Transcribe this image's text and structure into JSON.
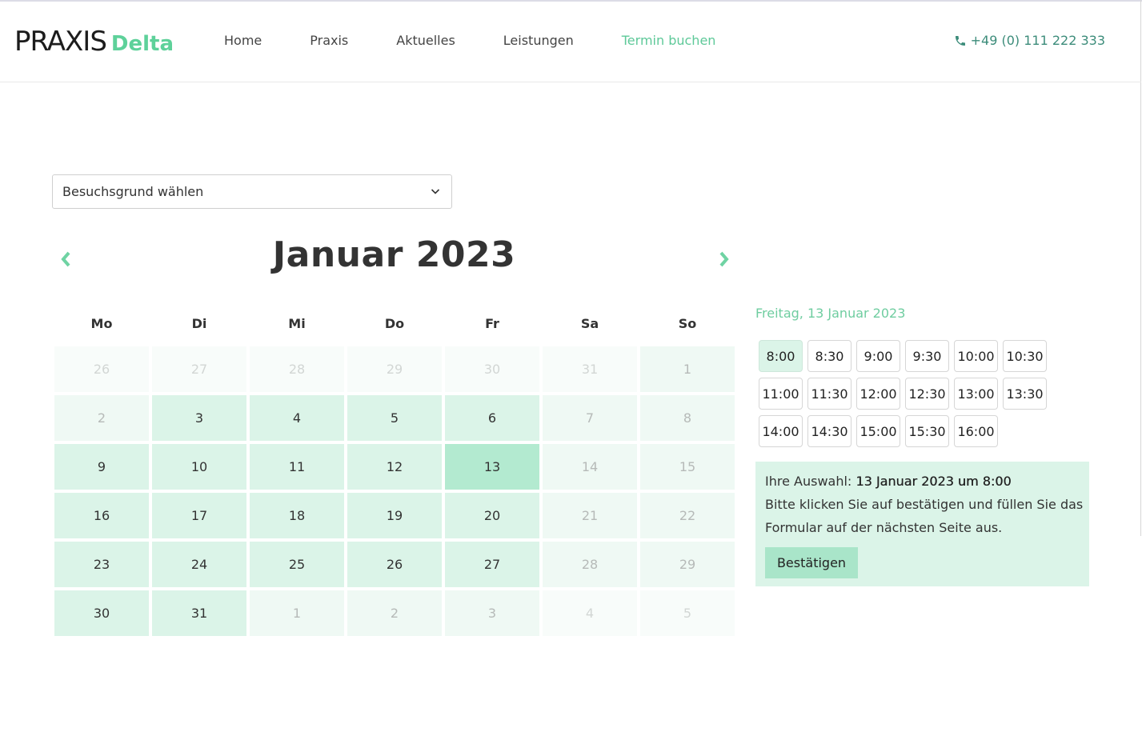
{
  "logo": {
    "main": "PRAXIS",
    "accent": "Delta"
  },
  "nav": [
    {
      "label": "Home",
      "active": false
    },
    {
      "label": "Praxis",
      "active": false
    },
    {
      "label": "Aktuelles",
      "active": false
    },
    {
      "label": "Leistungen",
      "active": false
    },
    {
      "label": "Termin buchen",
      "active": true
    }
  ],
  "phone": {
    "icon": "phone-icon",
    "number": "+49 (0) 111 222 333"
  },
  "select": {
    "label": "Besuchsgrund wählen",
    "icon": "chevron-down-icon"
  },
  "calendar": {
    "title": "Januar 2023",
    "prev_icon": "chevron-left-icon",
    "next_icon": "chevron-right-icon",
    "weekdays": [
      "Mo",
      "Di",
      "Mi",
      "Do",
      "Fr",
      "Sa",
      "So"
    ],
    "days": [
      {
        "d": "26",
        "s": "out"
      },
      {
        "d": "27",
        "s": "out"
      },
      {
        "d": "28",
        "s": "out"
      },
      {
        "d": "29",
        "s": "out"
      },
      {
        "d": "30",
        "s": "out"
      },
      {
        "d": "31",
        "s": "out"
      },
      {
        "d": "1",
        "s": "off"
      },
      {
        "d": "2",
        "s": "off"
      },
      {
        "d": "3",
        "s": "avail"
      },
      {
        "d": "4",
        "s": "avail"
      },
      {
        "d": "5",
        "s": "avail"
      },
      {
        "d": "6",
        "s": "avail"
      },
      {
        "d": "7",
        "s": "off"
      },
      {
        "d": "8",
        "s": "off"
      },
      {
        "d": "9",
        "s": "avail"
      },
      {
        "d": "10",
        "s": "avail"
      },
      {
        "d": "11",
        "s": "avail"
      },
      {
        "d": "12",
        "s": "avail"
      },
      {
        "d": "13",
        "s": "sel"
      },
      {
        "d": "14",
        "s": "off"
      },
      {
        "d": "15",
        "s": "off"
      },
      {
        "d": "16",
        "s": "avail"
      },
      {
        "d": "17",
        "s": "avail"
      },
      {
        "d": "18",
        "s": "avail"
      },
      {
        "d": "19",
        "s": "avail"
      },
      {
        "d": "20",
        "s": "avail"
      },
      {
        "d": "21",
        "s": "off"
      },
      {
        "d": "22",
        "s": "off"
      },
      {
        "d": "23",
        "s": "avail"
      },
      {
        "d": "24",
        "s": "avail"
      },
      {
        "d": "25",
        "s": "avail"
      },
      {
        "d": "26",
        "s": "avail"
      },
      {
        "d": "27",
        "s": "avail"
      },
      {
        "d": "28",
        "s": "off"
      },
      {
        "d": "29",
        "s": "off"
      },
      {
        "d": "30",
        "s": "avail"
      },
      {
        "d": "31",
        "s": "avail"
      },
      {
        "d": "1",
        "s": "off"
      },
      {
        "d": "2",
        "s": "off"
      },
      {
        "d": "3",
        "s": "off"
      },
      {
        "d": "4",
        "s": "out"
      },
      {
        "d": "5",
        "s": "out"
      }
    ]
  },
  "selected_date_heading": "Freitag, 13 Januar 2023",
  "time_slots": [
    {
      "t": "8:00",
      "selected": true
    },
    {
      "t": "8:30",
      "selected": false
    },
    {
      "t": "9:00",
      "selected": false
    },
    {
      "t": "9:30",
      "selected": false
    },
    {
      "t": "10:00",
      "selected": false
    },
    {
      "t": "10:30",
      "selected": false
    },
    {
      "t": "11:00",
      "selected": false
    },
    {
      "t": "11:30",
      "selected": false
    },
    {
      "t": "12:00",
      "selected": false
    },
    {
      "t": "12:30",
      "selected": false
    },
    {
      "t": "13:00",
      "selected": false
    },
    {
      "t": "13:30",
      "selected": false
    },
    {
      "t": "14:00",
      "selected": false
    },
    {
      "t": "14:30",
      "selected": false
    },
    {
      "t": "15:00",
      "selected": false
    },
    {
      "t": "15:30",
      "selected": false
    },
    {
      "t": "16:00",
      "selected": false
    }
  ],
  "summary": {
    "prefix": "Ihre Auswahl: ",
    "selection": "13 Januar 2023 um 8:00",
    "line2": "Bitte klicken Sie auf bestätigen und füllen Sie das",
    "line3": "Formular auf der nächsten Seite aus.",
    "button": "Bestätigen"
  },
  "colors": {
    "accent": "#5ed19a",
    "nav_active": "#5ec999",
    "phone": "#3c8c7a",
    "day_available": "#dbf4e8",
    "day_selected": "#b3ead0",
    "summary_bg": "#dbf4e8",
    "button_bg": "#a9e5c9"
  }
}
